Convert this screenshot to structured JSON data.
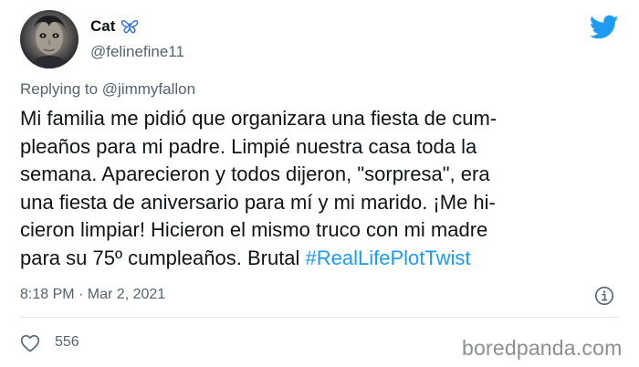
{
  "author": {
    "display_name": "Cat",
    "handle": "@felinefine11",
    "badge_icon": "butterfly-icon"
  },
  "reply": {
    "prefix": "Replying to ",
    "target": "@jimmyfallon"
  },
  "tweet": {
    "lines": [
      "Mi familia me pidió que organizara una fiesta de cum-",
      "pleaños para mi padre. Limpié nuestra casa toda la",
      "semana. Aparecieron y todos dijeron, \"sorpresa\", era",
      "una fiesta de aniversario para mí y mi marido. ¡Me hi-",
      "cieron limpiar! Hicieron el mismo truco con mi madre",
      "para su 75º cumpleaños. Brutal "
    ],
    "hashtag": "#RealLifePlotTwist",
    "timestamp": "8:18 PM · Mar 2, 2021"
  },
  "actions": {
    "like_count": "556"
  },
  "watermark": "boredpanda.com",
  "colors": {
    "twitter_blue": "#1d9bf0",
    "secondary_text": "#536471",
    "primary_text": "#0f1419",
    "butterfly": "#2b6fd6"
  }
}
